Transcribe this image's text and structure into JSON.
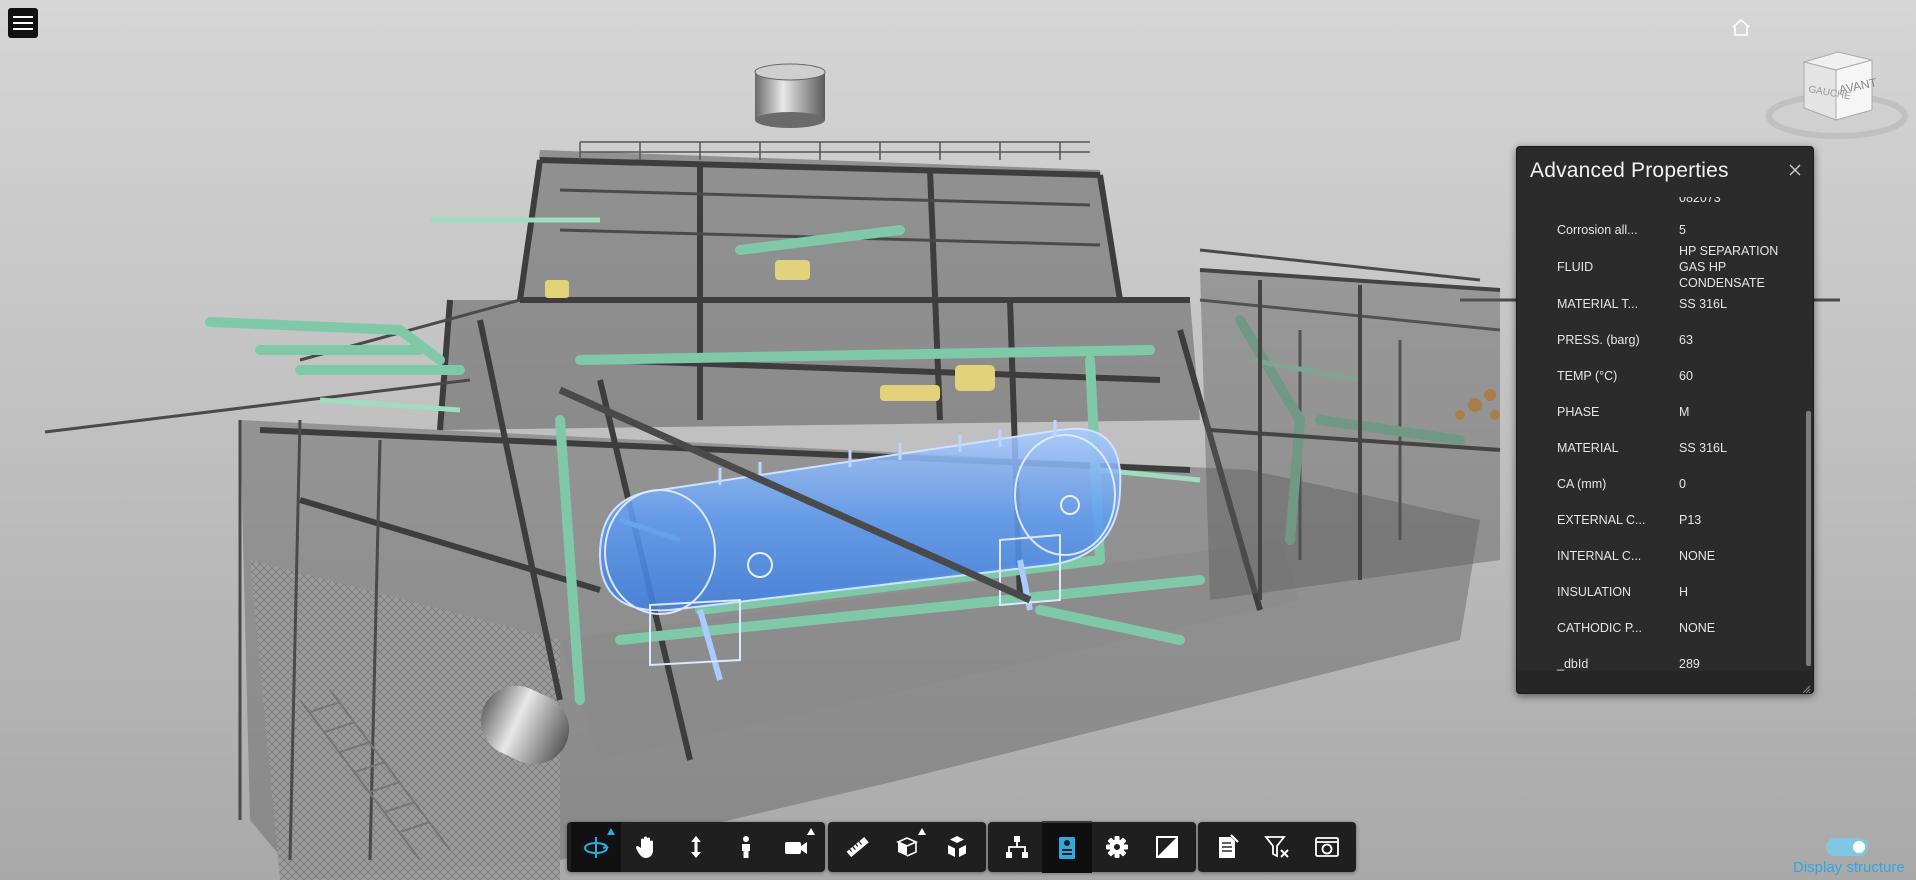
{
  "panel": {
    "title": "Advanced Properties",
    "properties": [
      {
        "name": "",
        "value": "082073"
      },
      {
        "name": "Corrosion all...",
        "value": "5"
      },
      {
        "name": "FLUID",
        "value": "HP SEPARATION GAS HP CONDENSATE"
      },
      {
        "name": "MATERIAL T...",
        "value": "SS 316L"
      },
      {
        "name": "PRESS. (barg)",
        "value": "63"
      },
      {
        "name": "TEMP (°C)",
        "value": "60"
      },
      {
        "name": "PHASE",
        "value": "M"
      },
      {
        "name": "MATERIAL",
        "value": "SS 316L"
      },
      {
        "name": "CA (mm)",
        "value": "0"
      },
      {
        "name": "EXTERNAL C...",
        "value": "P13"
      },
      {
        "name": "INTERNAL C...",
        "value": "NONE"
      },
      {
        "name": "INSULATION",
        "value": "H"
      },
      {
        "name": "CATHODIC P...",
        "value": "NONE"
      },
      {
        "name": "_dbId",
        "value": "289"
      }
    ]
  },
  "viewcube": {
    "left_face": "GAUCHE",
    "front_face": "AVANT"
  },
  "toolbar": {
    "groups": [
      [
        "orbit-icon",
        "pan-icon",
        "zoom-icon",
        "first-person-icon",
        "camera-icon"
      ],
      [
        "measure-icon",
        "section-icon",
        "explode-icon"
      ],
      [
        "model-browser-icon",
        "properties-icon",
        "settings-icon",
        "fullscreen-icon"
      ],
      [
        "document-icon",
        "filter-clear-icon",
        "screenshot-icon"
      ]
    ]
  },
  "display_structure": {
    "label": "Display structure",
    "enabled": true
  },
  "colors": {
    "panel_bg": "#2b2b2b",
    "toolbar_bg": "#1f1f1f",
    "accent_blue": "#2fa8e0",
    "pipe_green": "#7fc9a8",
    "vessel_blue": "#6aa8ff"
  }
}
